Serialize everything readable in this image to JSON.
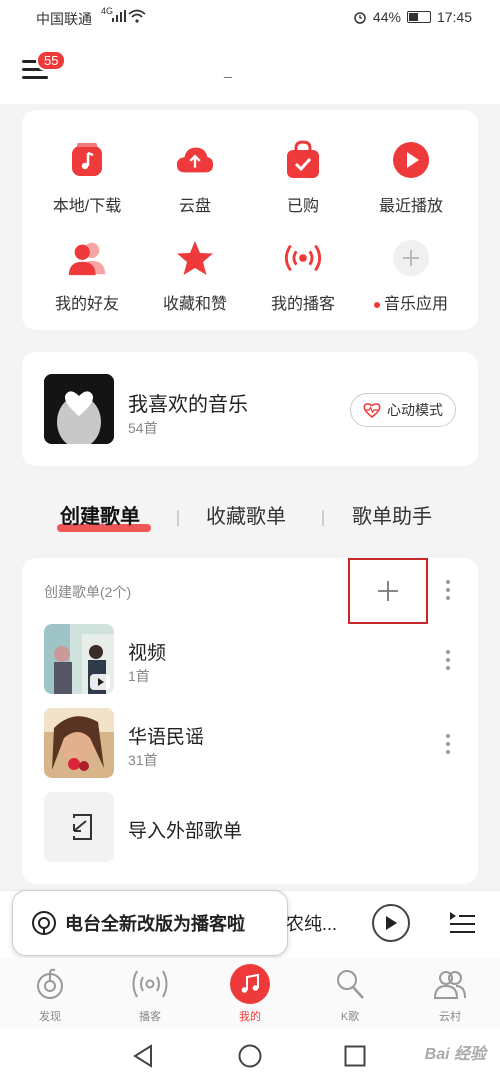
{
  "status_bar": {
    "carrier": "中国联通",
    "network": "4G",
    "battery": "44%",
    "time": "17:45"
  },
  "header": {
    "notification_count": "55",
    "title": "_"
  },
  "quick_grid": [
    {
      "label": "本地/下载",
      "icon": "music-note-icon"
    },
    {
      "label": "云盘",
      "icon": "cloud-upload-icon"
    },
    {
      "label": "已购",
      "icon": "shopping-bag-icon"
    },
    {
      "label": "最近播放",
      "icon": "play-circle-icon"
    },
    {
      "label": "我的好友",
      "icon": "friends-icon"
    },
    {
      "label": "收藏和赞",
      "icon": "star-icon"
    },
    {
      "label": "我的播客",
      "icon": "podcast-icon"
    },
    {
      "label": "音乐应用",
      "icon": "plus-icon"
    }
  ],
  "favorite": {
    "title": "我喜欢的音乐",
    "count": "54首",
    "mode_label": "心动模式"
  },
  "tabs": [
    "创建歌单",
    "收藏歌单",
    "歌单助手"
  ],
  "playlists": {
    "header": "创建歌单(2个)",
    "items": [
      {
        "name": "视频",
        "count": "1首"
      },
      {
        "name": "华语民谣",
        "count": "31首"
      }
    ],
    "import_label": "导入外部歌单"
  },
  "player": {
    "tooltip": "电台全新改版为播客啦",
    "snippet": "农纯..."
  },
  "bottom_nav": [
    {
      "label": "发现"
    },
    {
      "label": "播客"
    },
    {
      "label": "我的"
    },
    {
      "label": "K歌"
    },
    {
      "label": "云村"
    }
  ],
  "watermark": "Bai 经验",
  "colors": {
    "accent": "#ee3a3a",
    "highlight_box": "#c8282c"
  }
}
